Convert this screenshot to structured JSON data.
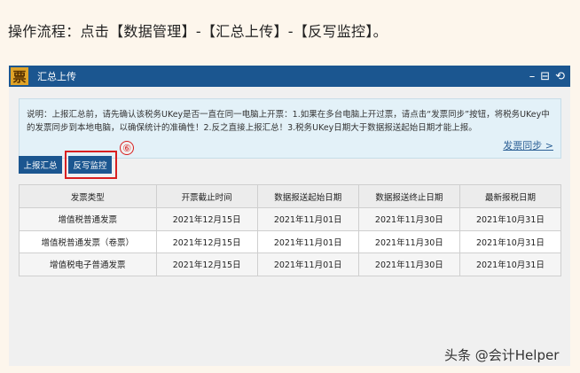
{
  "intro": "操作流程：点击【数据管理】-【汇总上传】-【反写监控】。",
  "window": {
    "logo": "票",
    "title": "汇总上传",
    "controls": [
      "–",
      "⊟",
      "⟲"
    ]
  },
  "notice": {
    "text": "说明：上报汇总前，请先确认该税务UKey是否一直在同一电脑上开票：1.如果在多台电脑上开过票，请点击“发票同步”按钮，将税务UKey中的发票同步到本地电脑，以确保统计的准确性！2.反之直接上报汇总！3.税务UKey日期大于数据报送起始日期才能上报。",
    "sync_link": "发票同步 >"
  },
  "buttons": {
    "report": "上报汇总",
    "writeback": "反写监控"
  },
  "step": "⑥",
  "table": {
    "headers": [
      "发票类型",
      "开票截止时间",
      "数据报送起始日期",
      "数据报送终止日期",
      "最新报税日期"
    ],
    "rows": [
      [
        "增值税普通发票",
        "2021年12月15日",
        "2021年11月01日",
        "2021年11月30日",
        "2021年10月31日"
      ],
      [
        "增值税普通发票（卷票）",
        "2021年12月15日",
        "2021年11月01日",
        "2021年11月30日",
        "2021年10月31日"
      ],
      [
        "增值税电子普通发票",
        "2021年12月15日",
        "2021年11月01日",
        "2021年11月30日",
        "2021年10月31日"
      ]
    ]
  },
  "watermark": "头条 @会计Helper"
}
